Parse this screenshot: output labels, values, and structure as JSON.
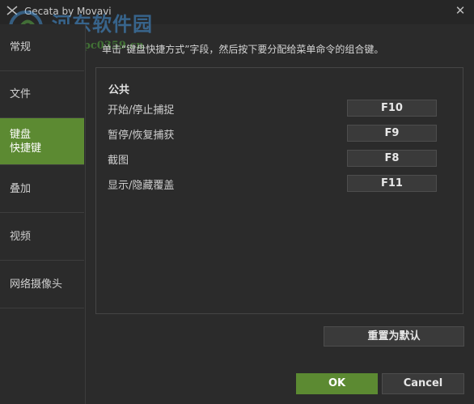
{
  "window": {
    "title": "Gecata by Movavi",
    "close_glyph": "✕"
  },
  "watermark": {
    "text": "河东软件园",
    "url": "www.pc0359.cn"
  },
  "sidebar": {
    "items": [
      {
        "label": "常规",
        "active": false
      },
      {
        "label": "文件",
        "active": false
      },
      {
        "label": "键盘\n快捷键",
        "active": true
      },
      {
        "label": "叠加",
        "active": false
      },
      {
        "label": "视频",
        "active": false
      },
      {
        "label": "网络摄像头",
        "active": false
      }
    ]
  },
  "main": {
    "instruction": "单击“键盘快捷方式”字段，然后按下要分配给菜单命令的组合键。",
    "section_title": "公共",
    "shortcuts": [
      {
        "label": "开始/停止捕捉",
        "key": "F10"
      },
      {
        "label": "暂停/恢复捕获",
        "key": "F9"
      },
      {
        "label": "截图",
        "key": "F8"
      },
      {
        "label": "显示/隐藏覆盖",
        "key": "F11"
      }
    ],
    "reset_label": "重置为默认"
  },
  "footer": {
    "ok_label": "OK",
    "cancel_label": "Cancel"
  },
  "colors": {
    "accent": "#5c8a32",
    "background": "#2b2b2b",
    "field": "#3a3a3a"
  }
}
